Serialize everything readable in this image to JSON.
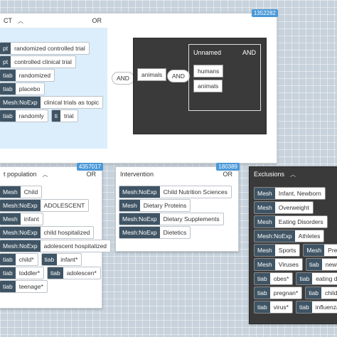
{
  "top_card": {
    "id_badge": "1352282",
    "title": "CT",
    "operator": "OR",
    "tags": [
      {
        "k": "pt",
        "t": "randomized controlled trial"
      },
      {
        "k": "pt",
        "t": "controlled clinical trial"
      },
      {
        "k": "tiab",
        "t": "randomized"
      },
      {
        "k": "tiab",
        "t": "placebo"
      },
      {
        "k": "Mesh:NoExp",
        "t": "clinical trials as topic"
      },
      {
        "k": "tiab",
        "t": "randomly"
      },
      {
        "k": "ti",
        "t": "trial"
      }
    ],
    "and_label": "AND",
    "dark_group": {
      "term": "animals",
      "and_label": "AND",
      "unnamed": {
        "title": "Unnamed",
        "operator": "AND",
        "items": [
          "humans",
          "animals"
        ]
      }
    }
  },
  "population_card": {
    "id_badge": "4357017",
    "title": "t population",
    "operator": "OR",
    "tags": [
      {
        "k": "Mesh",
        "t": "Child"
      },
      {
        "k": "Mesh:NoExp",
        "t": "ADOLESCENT"
      },
      {
        "k": "Mesh",
        "t": "infant"
      },
      {
        "k": "Mesh:NoExp",
        "t": "child hospitalized"
      },
      {
        "k": "Mesh:NoExp",
        "t": "adolescent hospitalized"
      },
      {
        "k": "tiab",
        "t": "child*"
      },
      {
        "k": "tiab",
        "t": "infant*"
      },
      {
        "k": "tiab",
        "t": "toddler*"
      },
      {
        "k": "tiab",
        "t": "adolescen*"
      },
      {
        "k": "tiab",
        "t": "teenage*"
      }
    ]
  },
  "intervention_card": {
    "id_badge": "180389",
    "title": "Intervention",
    "operator": "OR",
    "tags": [
      {
        "k": "Mesh:NoExp",
        "t": "Child Nutrition Sciences"
      },
      {
        "k": "Mesh",
        "t": "Dietary Proteins"
      },
      {
        "k": "Mesh:NoExp",
        "t": "Dietary Supplements"
      },
      {
        "k": "Mesh:NoExp",
        "t": "Dietetics"
      }
    ]
  },
  "exclusions_card": {
    "title": "Exclusions",
    "tags": [
      {
        "k": "Mesh",
        "t": "Infant, Newborn"
      },
      {
        "k": "Mesh",
        "t": "Overweight"
      },
      {
        "k": "Mesh",
        "t": "Eating Disorders"
      },
      {
        "k": "Mesh:NoExp",
        "t": "Athletes"
      },
      {
        "k": "Mesh",
        "t": "Sports"
      },
      {
        "k": "Mesh",
        "t": "Preg"
      },
      {
        "k": "Mesh",
        "t": "Viruses"
      },
      {
        "k": "tiab",
        "t": "newb"
      },
      {
        "k": "tiab",
        "t": "obes*"
      },
      {
        "k": "tiab",
        "t": "eating di"
      },
      {
        "k": "tiab",
        "t": "pregnan*"
      },
      {
        "k": "tiab",
        "t": "child"
      },
      {
        "k": "tiab",
        "t": "virus*"
      },
      {
        "k": "tiab",
        "t": "influenza"
      }
    ]
  }
}
